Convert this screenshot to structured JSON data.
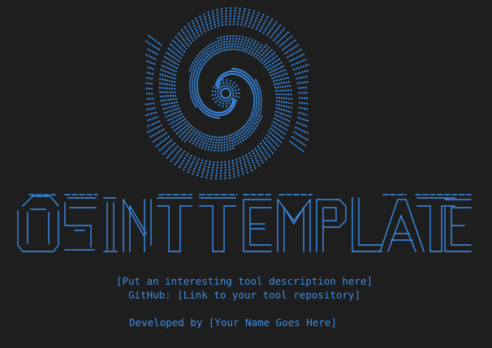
{
  "theme": {
    "background": "#1e1e1e",
    "accent": "#3b8eea"
  },
  "banner": {
    "logo": "galaxy-spiral-logo",
    "title_art": "OSINT TEMPLATE"
  },
  "info": {
    "description": "[Put an interesting tool description here]",
    "github": "GitHub: [Link to your tool repository]",
    "developer": "Developed by [Your Name Goes Here]"
  }
}
